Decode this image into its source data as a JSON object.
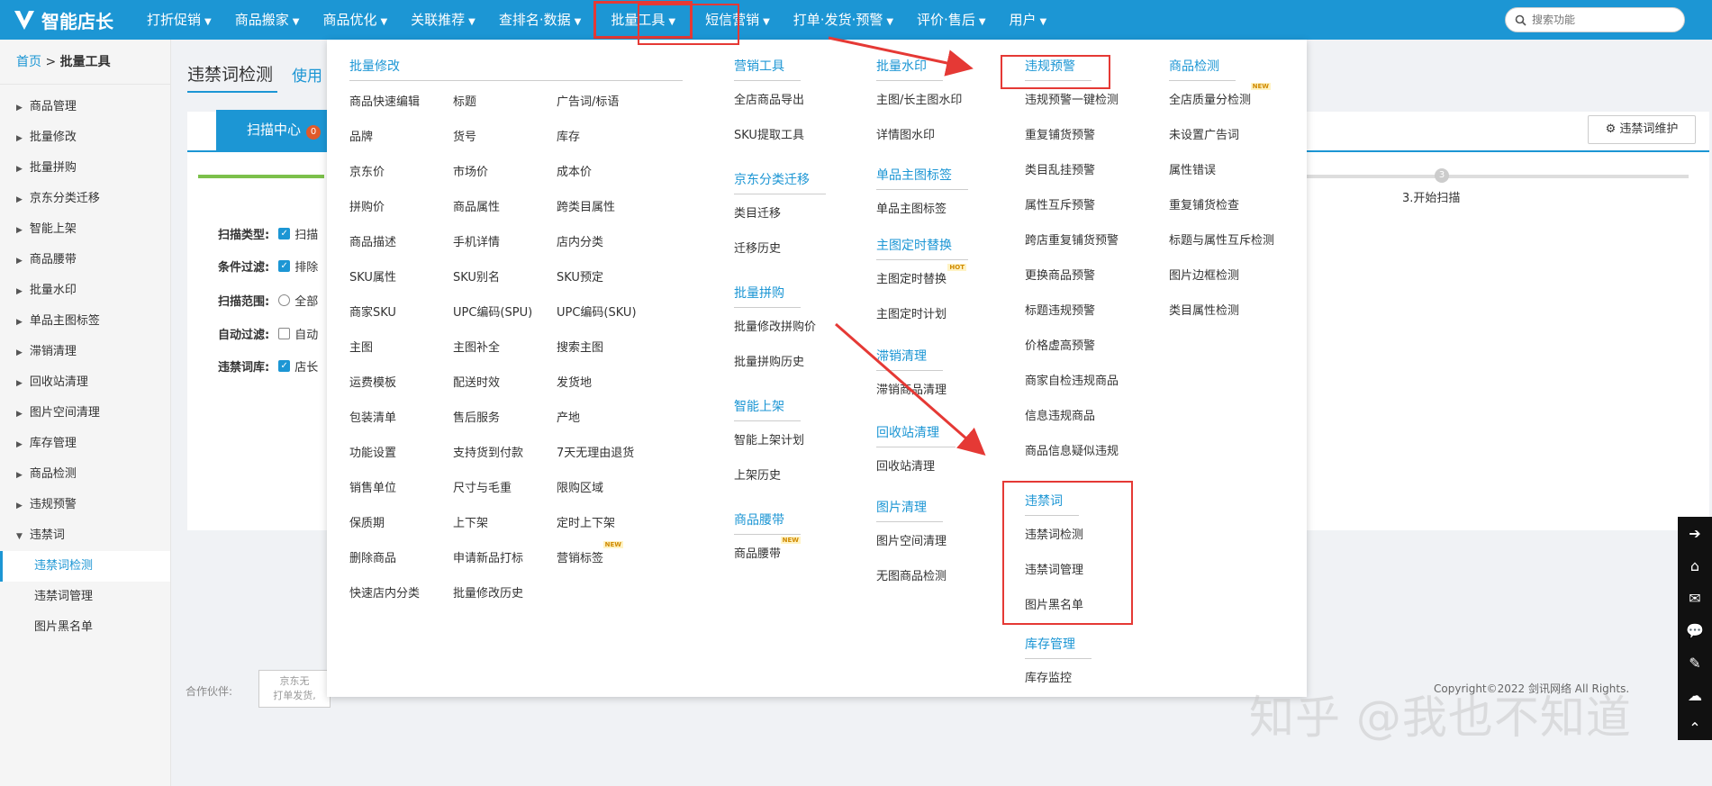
{
  "brand": {
    "name": "智能店长"
  },
  "nav": {
    "items": [
      {
        "label": "打折促销"
      },
      {
        "label": "商品搬家"
      },
      {
        "label": "商品优化"
      },
      {
        "label": "关联推荐"
      },
      {
        "label": "查排名·数据"
      },
      {
        "label": "批量工具"
      },
      {
        "label": "短信营销"
      },
      {
        "label": "打单·发货·预警"
      },
      {
        "label": "评价·售后"
      },
      {
        "label": "用户"
      }
    ],
    "search_placeholder": "搜索功能"
  },
  "breadcrumb": {
    "home": "首页",
    "sep": " > ",
    "current": "批量工具"
  },
  "sidebar": {
    "items": [
      {
        "label": "商品管理"
      },
      {
        "label": "批量修改"
      },
      {
        "label": "批量拼购"
      },
      {
        "label": "京东分类迁移"
      },
      {
        "label": "智能上架"
      },
      {
        "label": "商品腰带"
      },
      {
        "label": "批量水印"
      },
      {
        "label": "单品主图标签"
      },
      {
        "label": "滞销清理"
      },
      {
        "label": "回收站清理"
      },
      {
        "label": "图片空间清理"
      },
      {
        "label": "库存管理"
      },
      {
        "label": "商品检测"
      },
      {
        "label": "违规预警"
      },
      {
        "label": "违禁词"
      }
    ],
    "subitems": [
      {
        "label": "违禁词检测"
      },
      {
        "label": "违禁词管理"
      },
      {
        "label": "图片黑名单"
      }
    ]
  },
  "main": {
    "title": "违禁词检测",
    "title2": "使用",
    "tab": "扫描中心",
    "tab_badge": "0",
    "step3_num": "3",
    "step3_label": "3.开始扫描",
    "maintain_btn": "违禁词维护",
    "form": {
      "scan_type": "扫描类型:",
      "scan_type_val": "扫描",
      "filter": "条件过滤:",
      "filter_val": "排除",
      "range": "扫描范围:",
      "range_val": "全部",
      "auto": "自动过滤:",
      "auto_val": "自动",
      "lib": "违禁词库:",
      "lib_val": "店长"
    },
    "partner_label": "合作伙伴:",
    "partner_text": "京东无\n打单发货,",
    "copyright": "Copyright©2022 剑讯网络 All Rights."
  },
  "mega": {
    "batch_edit": {
      "title": "批量修改",
      "items": [
        "商品快速编辑",
        "标题",
        "广告词/标语",
        "品牌",
        "货号",
        "库存",
        "京东价",
        "市场价",
        "成本价",
        "拼购价",
        "商品属性",
        "跨类目属性",
        "商品描述",
        "手机详情",
        "店内分类",
        "SKU属性",
        "SKU别名",
        "SKU预定",
        "商家SKU",
        "UPC编码(SPU)",
        "UPC编码(SKU)",
        "主图",
        "主图补全",
        "搜索主图",
        "运费模板",
        "配送时效",
        "发货地",
        "包装清单",
        "售后服务",
        "产地",
        "功能设置",
        "支持货到付款",
        "7天无理由退货",
        "销售单位",
        "尺寸与毛重",
        "限购区域",
        "保质期",
        "上下架",
        "定时上下架",
        "删除商品",
        "申请新品打标",
        "营销标签",
        "快速店内分类",
        "批量修改历史",
        ""
      ]
    },
    "marketing": {
      "title": "营销工具",
      "items": [
        "全店商品导出",
        "SKU提取工具"
      ]
    },
    "jd_migrate": {
      "title": "京东分类迁移",
      "items": [
        "类目迁移",
        "迁移历史"
      ]
    },
    "batch_pin": {
      "title": "批量拼购",
      "items": [
        "批量修改拼购价",
        "批量拼购历史"
      ]
    },
    "smart_shelf": {
      "title": "智能上架",
      "items": [
        "智能上架计划",
        "上架历史"
      ]
    },
    "belt": {
      "title": "商品腰带",
      "items": [
        "商品腰带"
      ]
    },
    "watermark": {
      "title": "批量水印",
      "items": [
        "主图/长主图水印",
        "详情图水印"
      ]
    },
    "tag": {
      "title": "单品主图标签",
      "items": [
        "单品主图标签"
      ]
    },
    "timer": {
      "title": "主图定时替换",
      "items": [
        "主图定时替换",
        "主图定时计划"
      ]
    },
    "slow": {
      "title": "滞销清理",
      "items": [
        "滞销商品清理"
      ]
    },
    "recycle": {
      "title": "回收站清理",
      "items": [
        "回收站清理"
      ]
    },
    "img_clean": {
      "title": "图片清理",
      "items": [
        "图片空间清理",
        "无图商品检测"
      ]
    },
    "violation": {
      "title": "违规预警",
      "items": [
        "违规预警一键检测",
        "重复铺货预警",
        "类目乱挂预警",
        "属性互斥预警",
        "跨店重复铺货预警",
        "更换商品预警",
        "标题违规预警",
        "价格虚高预警",
        "商家自检违规商品",
        "信息违规商品",
        "商品信息疑似违规"
      ]
    },
    "banned": {
      "title": "违禁词",
      "items": [
        "违禁词检测",
        "违禁词管理",
        "图片黑名单"
      ]
    },
    "stock": {
      "title": "库存管理",
      "items": [
        "库存监控"
      ]
    },
    "detect": {
      "title": "商品检测",
      "items": [
        "全店质量分检测",
        "未设置广告词",
        "属性错误",
        "重复铺货检查",
        "标题与属性互斥检测",
        "图片边框检测",
        "类目属性检测"
      ]
    },
    "badges": {
      "new": "NEW",
      "hot": "HOT"
    }
  },
  "watermark_text": "知乎 @我也不知道",
  "colors": {
    "primary": "#1c96d4",
    "highlight_box": "#e53935"
  }
}
